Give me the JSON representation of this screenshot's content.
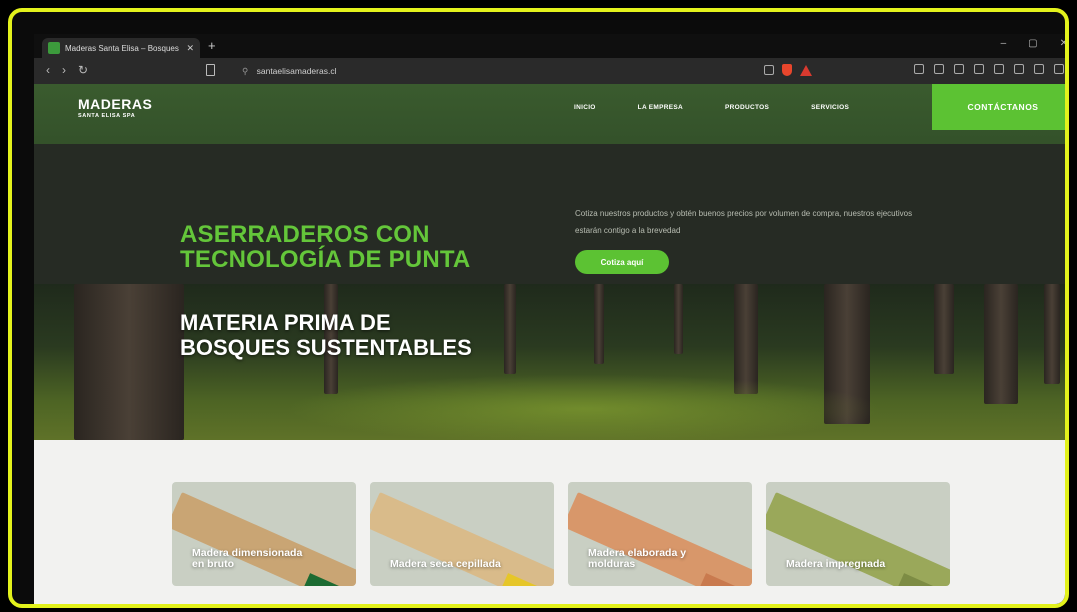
{
  "browser": {
    "tab_title": "Maderas Santa Elisa – Bosques s",
    "tab_close": "✕",
    "new_tab": "+",
    "url": "santaelisamaderas.cl",
    "nav": {
      "back": "‹",
      "forward": "›",
      "reload": "↻"
    },
    "window_controls": {
      "minimize": "‒",
      "maximize": "▢",
      "close": "✕"
    }
  },
  "site": {
    "logo": {
      "main": "MADERAS",
      "sub": "SANTA ELISA SPA"
    },
    "nav": [
      "INICIO",
      "LA EMPRESA",
      "PRODUCTOS",
      "SERVICIOS"
    ],
    "cta": "CONTÁCTANOS",
    "headline_green": [
      "ASERRADEROS CON",
      "TECNOLOGÍA DE PUNTA"
    ],
    "promo_text": "Cotiza nuestros productos y obtén buenos precios por volumen de compra, nuestros ejecutivos estarán contigo a la brevedad",
    "quote_button": "Cotiza aquí",
    "headline_white": [
      "MATERIA PRIMA DE",
      "BOSQUES SUSTENTABLES"
    ],
    "products": [
      {
        "label": "Madera dimensionada\nen bruto",
        "plank_color": "#c9a574",
        "end_color": "#1c6b32"
      },
      {
        "label": "Madera seca cepillada",
        "plank_color": "#d9bb8a",
        "end_color": "#e6c629"
      },
      {
        "label": "Madera elaborada y\nmolduras",
        "plank_color": "#d8976a",
        "end_color": "#c97a4e"
      },
      {
        "label": "Madera impregnada",
        "plank_color": "#9aa85a",
        "end_color": "#7d8c44"
      }
    ]
  },
  "colors": {
    "frame": "#e3f21c",
    "accent_green": "#5cc233",
    "headline_green": "#64c63a"
  }
}
